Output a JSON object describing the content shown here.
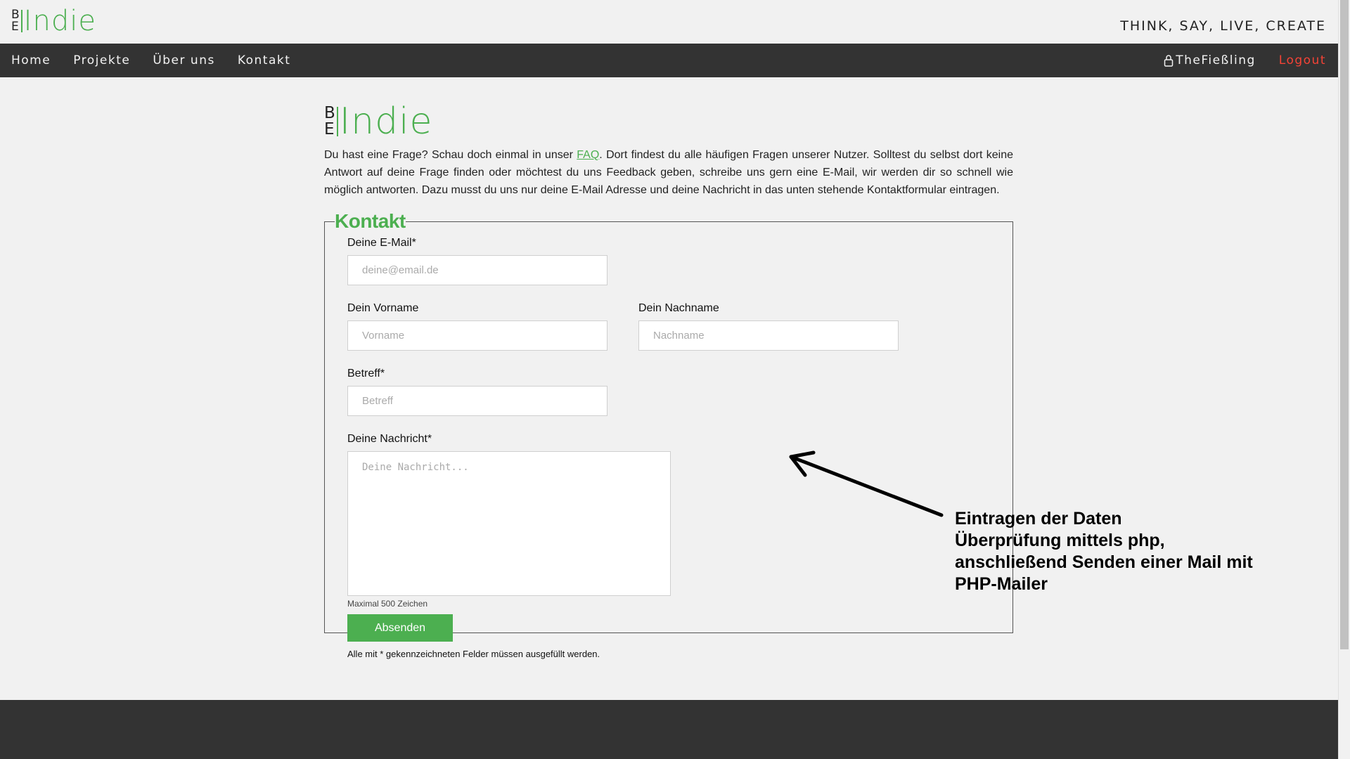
{
  "header": {
    "logo_be_top": "B",
    "logo_be_bottom": "E",
    "logo_indie": "Indie",
    "slogan": "THINK, SAY, LIVE, CREATE"
  },
  "nav": {
    "items": [
      {
        "label": "Home"
      },
      {
        "label": "Projekte"
      },
      {
        "label": "Über uns"
      },
      {
        "label": "Kontakt"
      }
    ],
    "user": "TheFießling",
    "logout": "Logout",
    "accent_logout": "#f44336"
  },
  "intro": {
    "before_link": "Du hast eine Frage? Schau doch einmal in unser ",
    "link": "FAQ",
    "after_link": ". Dort findest du alle häufigen Fragen unserer Nutzer. Solltest du selbst dort keine Antwort auf deine Frage finden oder möchtest du uns Feedback geben, schreibe uns gern eine E-Mail, wir werden dir so schnell wie möglich antworten. Dazu musst du uns nur deine E-Mail Adresse und deine Nachricht in das unten stehende Kontaktformular eintragen."
  },
  "form": {
    "legend": "Kontakt",
    "email_label": "Deine E-Mail*",
    "email_placeholder": "deine@email.de",
    "firstname_label": "Dein Vorname",
    "firstname_placeholder": "Vorname",
    "lastname_label": "Dein Nachname",
    "lastname_placeholder": "Nachname",
    "subject_label": "Betreff*",
    "subject_placeholder": "Betreff",
    "message_label": "Deine Nachricht*",
    "message_placeholder": "Deine Nachricht...",
    "message_hint": "Maximal 500 Zeichen",
    "submit_label": "Absenden",
    "required_note": "Alle mit * gekennzeichneten Felder müssen ausgefüllt werden."
  },
  "annotation": {
    "lines": [
      "Eintragen der Daten",
      "Überprüfung mittels php,",
      "anschließend Senden einer Mail mit",
      "PHP-Mailer"
    ]
  },
  "colors": {
    "brand_green": "#4caf50",
    "nav_dark": "#333333",
    "background": "#f1f1f1"
  },
  "icons": {
    "user": "user-lock-icon",
    "arrow": "arrow-left-icon"
  }
}
